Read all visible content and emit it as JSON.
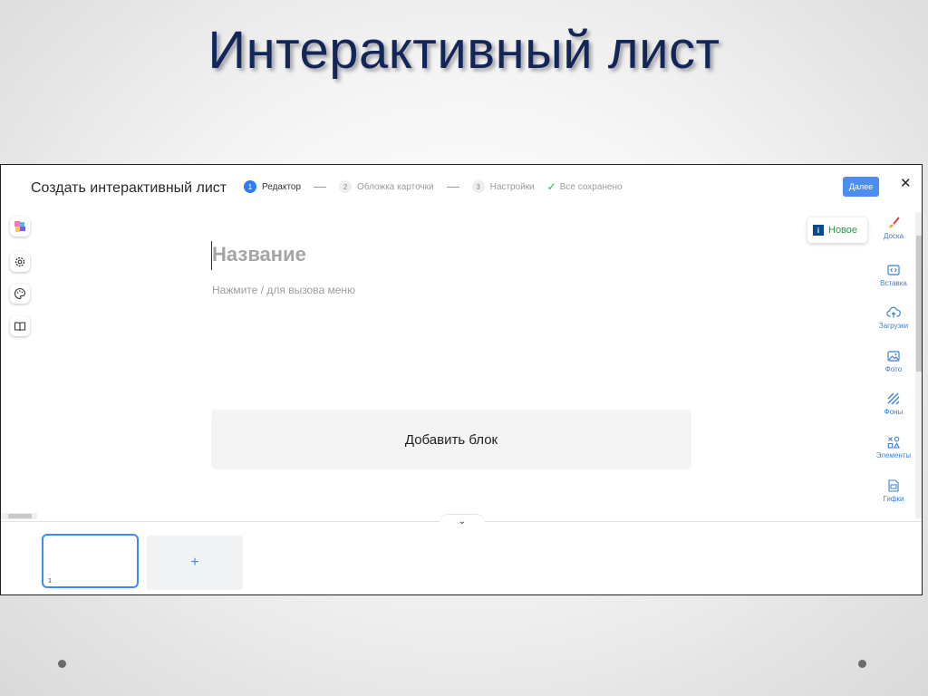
{
  "slide": {
    "title": "Интерактивный лист"
  },
  "editor": {
    "header_title": "Создать интерактивный лист",
    "steps": [
      {
        "num": "1",
        "label": "Редактор",
        "active": true
      },
      {
        "num": "2",
        "label": "Обложка карточки",
        "active": false
      },
      {
        "num": "3",
        "label": "Настройки",
        "active": false
      }
    ],
    "saved_label": "Все сохранено",
    "next_label": "Далее",
    "close_glyph": "✕",
    "left_tools": [
      "logo-icon",
      "settings-icon",
      "palette-icon",
      "book-icon"
    ],
    "title_placeholder": "Название",
    "hint": "Нажмите / для вызова меню",
    "add_block_label": "Добавить блок",
    "new_badge": {
      "icon_letter": "i",
      "label": "Новое"
    },
    "right_tools": [
      {
        "icon": "brush-icon",
        "label": "Доска"
      },
      {
        "icon": "embed-icon",
        "label": "Вставка"
      },
      {
        "icon": "upload-icon",
        "label": "Загрузки"
      },
      {
        "icon": "photo-icon",
        "label": "Фото"
      },
      {
        "icon": "background-icon",
        "label": "Фоны"
      },
      {
        "icon": "shapes-icon",
        "label": "Элементы"
      },
      {
        "icon": "gif-icon",
        "label": "Гифки"
      }
    ],
    "collapse_glyph": "⌄",
    "page_thumbnails": [
      {
        "num": "1"
      }
    ],
    "add_page_glyph": "+"
  },
  "colors": {
    "title": "#13265a",
    "accent": "#2f7df6",
    "saved_check": "#2fb24a",
    "tool_label": "#3b7fd8"
  }
}
